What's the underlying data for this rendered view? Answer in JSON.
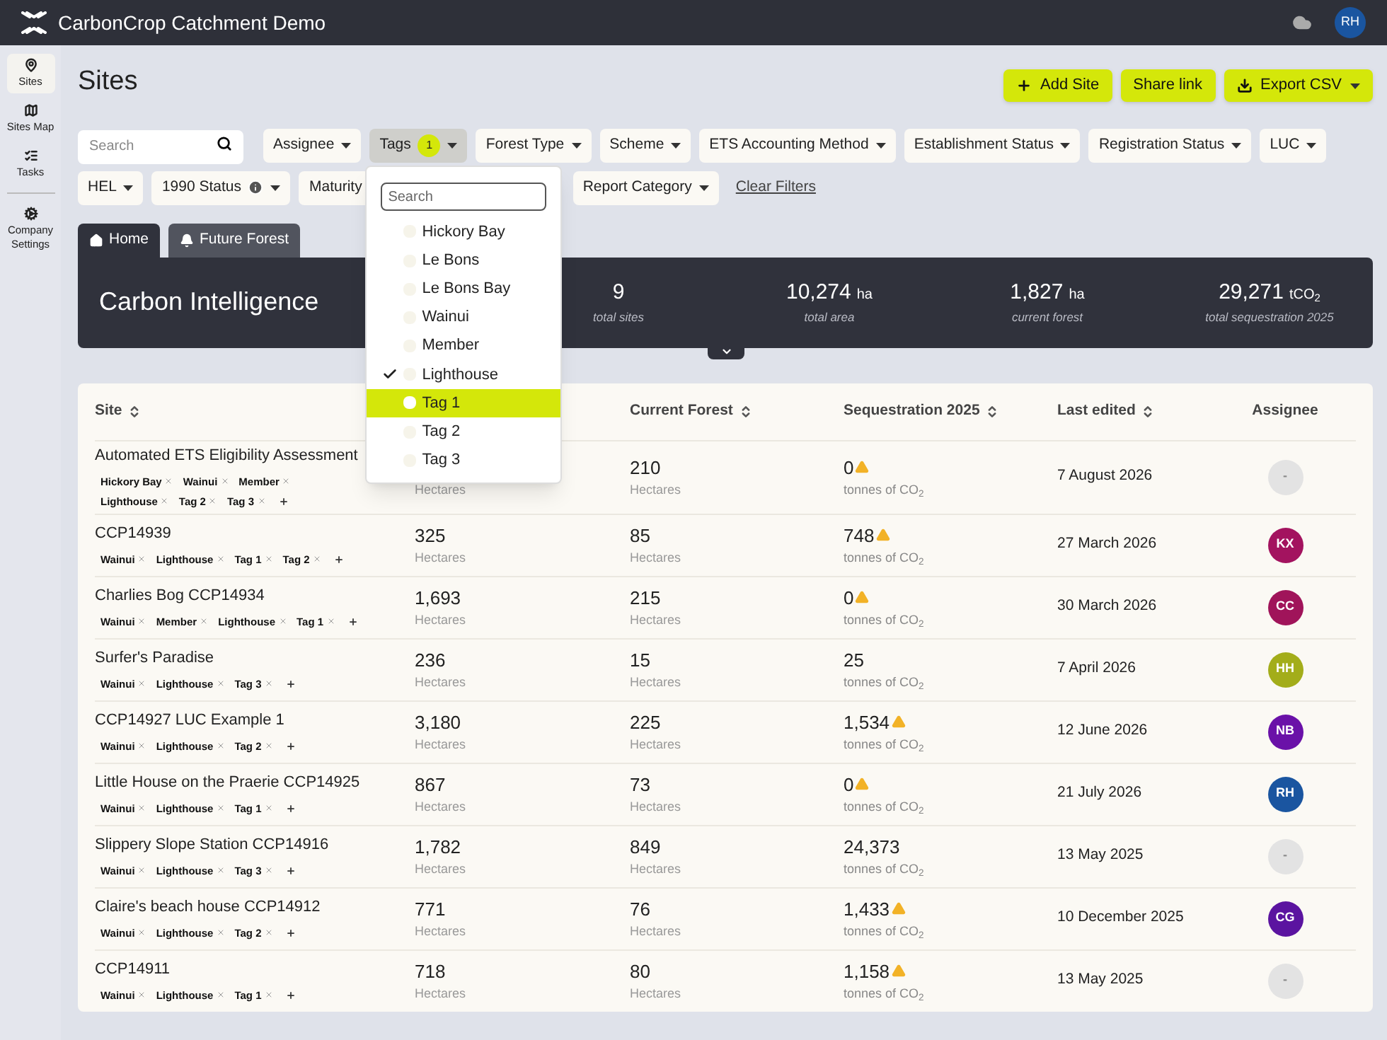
{
  "app": {
    "title": "CarbonCrop Catchment Demo",
    "user_initials": "RH"
  },
  "sidebar": {
    "items": [
      {
        "label": "Sites",
        "selected": true
      },
      {
        "label": "Sites Map",
        "selected": false
      },
      {
        "label": "Tasks",
        "selected": false
      },
      {
        "label": "Company Settings",
        "selected": false
      }
    ]
  },
  "page": {
    "title": "Sites",
    "actions": [
      {
        "label": "Add Site",
        "kind": "add"
      },
      {
        "label": "Share link",
        "kind": "plain"
      },
      {
        "label": "Export CSV",
        "kind": "export"
      }
    ]
  },
  "filters": {
    "search_placeholder": "Search",
    "rows": [
      [
        {
          "label": "Assignee"
        },
        {
          "label": "Tags",
          "count": "1",
          "open": true
        },
        {
          "label": "Forest Type"
        },
        {
          "label": "Scheme"
        },
        {
          "label": "ETS Accounting Method"
        },
        {
          "label": "Establishment Status"
        },
        {
          "label": "Registration Status"
        },
        {
          "label": "LUC"
        }
      ],
      [
        {
          "label": "HEL"
        },
        {
          "label": "1990 Status",
          "info": true
        },
        {
          "label": "Maturity"
        },
        {
          "label": "Report Category"
        }
      ]
    ],
    "clear": "Clear Filters"
  },
  "tag_menu": {
    "search_placeholder": "Search",
    "items": [
      {
        "label": "Hickory Bay",
        "checked": false,
        "hovered": false
      },
      {
        "label": "Le Bons",
        "checked": false,
        "hovered": false
      },
      {
        "label": "Le Bons Bay",
        "checked": false,
        "hovered": false
      },
      {
        "label": "Wainui",
        "checked": false,
        "hovered": false
      },
      {
        "label": "Member",
        "checked": false,
        "hovered": false
      },
      {
        "label": "Lighthouse",
        "checked": true,
        "hovered": false
      },
      {
        "label": "Tag 1",
        "checked": false,
        "hovered": true
      },
      {
        "label": "Tag 2",
        "checked": false,
        "hovered": false
      },
      {
        "label": "Tag 3",
        "checked": false,
        "hovered": false
      }
    ]
  },
  "views": [
    {
      "label": "Home",
      "selected": true
    },
    {
      "label": "Future Forest",
      "selected": false
    }
  ],
  "summary": {
    "title": "Carbon Intelligence",
    "stats": [
      {
        "value": "9",
        "label": "total sites"
      },
      {
        "value": "10,274",
        "unit": "ha",
        "label": "total area"
      },
      {
        "value": "1,827",
        "unit": "ha",
        "label": "current forest"
      },
      {
        "value": "29,271",
        "unit": "tCO$_{2}$",
        "label": "total sequestration 2025"
      }
    ]
  },
  "table": {
    "columns": [
      {
        "label": "Site",
        "sortable": true
      },
      {
        "label": "Current Forest",
        "sortable": true
      },
      {
        "label": "Sequestration 2025",
        "sortable": true
      },
      {
        "label": "Last edited",
        "sortable": true
      },
      {
        "label": "Assignee",
        "sortable": false
      }
    ],
    "rows": [
      {
        "site": "Automated ETS Eligibility Assessment",
        "tags": [
          "Hickory Bay",
          "Wainui",
          "Member",
          "Lighthouse",
          "Tag 2",
          "Tag 3"
        ],
        "area_unit": "Hectares",
        "forest": "210",
        "forest_unit": "Hectares",
        "seq": "0",
        "warning": true,
        "seq_unit": "tonnes of CO$_{2}$",
        "edited": "7 August 2026",
        "assignee": {
          "initials": "-",
          "color": "#e3e3e3"
        }
      },
      {
        "site": "CCP14939",
        "tags": [
          "Wainui",
          "Lighthouse",
          "Tag 1",
          "Tag 2"
        ],
        "area": "325",
        "area_unit": "Hectares",
        "forest": "85",
        "forest_unit": "Hectares",
        "seq": "748",
        "warning": true,
        "seq_unit": "tonnes of CO$_{2}$",
        "edited": "27 March 2026",
        "assignee": {
          "initials": "KX",
          "color": "#a3135f"
        }
      },
      {
        "site": "Charlies Bog CCP14934",
        "tags": [
          "Wainui",
          "Member",
          "Lighthouse",
          "Tag 1"
        ],
        "area": "1,693",
        "area_unit": "Hectares",
        "forest": "215",
        "forest_unit": "Hectares",
        "seq": "0",
        "warning": true,
        "seq_unit": "tonnes of CO$_{2}$",
        "edited": "30 March 2026",
        "assignee": {
          "initials": "CC",
          "color": "#a0145a"
        }
      },
      {
        "site": "Surfer's Paradise",
        "tags": [
          "Wainui",
          "Lighthouse",
          "Tag 3"
        ],
        "area": "236",
        "area_unit": "Hectares",
        "forest": "15",
        "forest_unit": "Hectares",
        "seq": "25",
        "warning": false,
        "seq_unit": "tonnes of CO$_{2}$",
        "edited": "7 April 2026",
        "assignee": {
          "initials": "HH",
          "color": "#a3ad1a"
        }
      },
      {
        "site": "CCP14927 LUC Example 1",
        "tags": [
          "Wainui",
          "Lighthouse",
          "Tag 2"
        ],
        "area": "3,180",
        "area_unit": "Hectares",
        "forest": "225",
        "forest_unit": "Hectares",
        "seq": "1,534",
        "warning": true,
        "seq_unit": "tonnes of CO$_{2}$",
        "edited": "12 June 2026",
        "assignee": {
          "initials": "NB",
          "color": "#6a11a8"
        }
      },
      {
        "site": "Little House on the Praerie CCP14925",
        "tags": [
          "Wainui",
          "Lighthouse",
          "Tag 1"
        ],
        "area": "867",
        "area_unit": "Hectares",
        "forest": "73",
        "forest_unit": "Hectares",
        "seq": "0",
        "warning": true,
        "seq_unit": "tonnes of CO$_{2}$",
        "edited": "21 July 2026",
        "assignee": {
          "initials": "RH",
          "color": "#1a55a0"
        }
      },
      {
        "site": "Slippery Slope Station CCP14916",
        "tags": [
          "Wainui",
          "Lighthouse",
          "Tag 3"
        ],
        "area": "1,782",
        "area_unit": "Hectares",
        "forest": "849",
        "forest_unit": "Hectares",
        "seq": "24,373",
        "warning": false,
        "seq_unit": "tonnes of CO$_{2}$",
        "edited": "13 May 2025",
        "assignee": {
          "initials": "-",
          "color": "#e3e3e3"
        }
      },
      {
        "site": "Claire's beach house CCP14912",
        "tags": [
          "Wainui",
          "Lighthouse",
          "Tag 2"
        ],
        "area": "771",
        "area_unit": "Hectares",
        "forest": "76",
        "forest_unit": "Hectares",
        "seq": "1,433",
        "warning": true,
        "seq_unit": "tonnes of CO$_{2}$",
        "edited": "10 December 2025",
        "assignee": {
          "initials": "CG",
          "color": "#5b14a0"
        }
      },
      {
        "site": "CCP14911",
        "tags": [
          "Wainui",
          "Lighthouse",
          "Tag 1"
        ],
        "area": "718",
        "area_unit": "Hectares",
        "forest": "80",
        "forest_unit": "Hectares",
        "seq": "1,158",
        "warning": true,
        "seq_unit": "tonnes of CO$_{2}$",
        "edited": "13 May 2025",
        "assignee": {
          "initials": "-",
          "color": "#e3e3e3"
        }
      }
    ]
  }
}
